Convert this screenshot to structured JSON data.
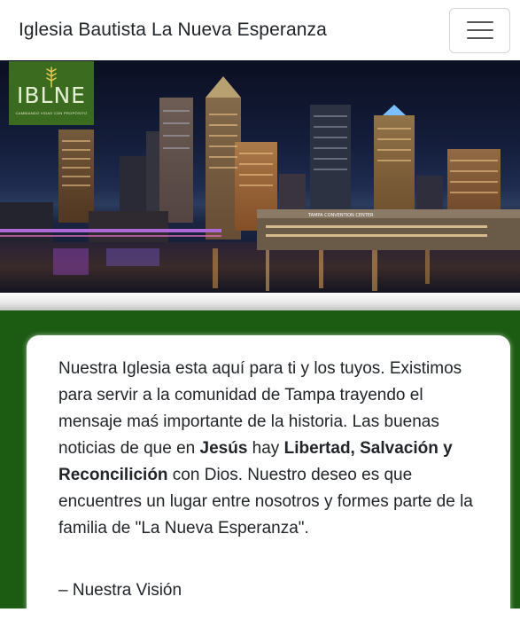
{
  "navbar": {
    "brand": "Iglesia Bautista La Nueva Esperanza",
    "menu_icon": "hamburger-menu-icon"
  },
  "logo": {
    "text": "IBLNE",
    "tagline": "CAMBIANDO VIDAS CON PROPÓSITO"
  },
  "hero": {
    "building_sign": "TAMPA CONVENTION CENTER"
  },
  "vision": {
    "part1": "Nuestra Iglesia esta aquí para ti y los tuyos. Existimos para servir a la comunidad de Tampa trayendo el mensaje maś importante de la historia. Las buenas noticias de que en ",
    "bold1": "Jesús",
    "part2": " hay ",
    "bold2": "Libertad, Salvación y Reconcilición",
    "part3": " con Dios. Nuestro deseo es que encuentres un lugar entre nosotros y formes parte de la familia de \"La Nueva Esperanza\".",
    "signature": "– Nuestra Visión"
  },
  "colors": {
    "section_green": "#1c5b12",
    "logo_green": "#3a6b1e"
  }
}
